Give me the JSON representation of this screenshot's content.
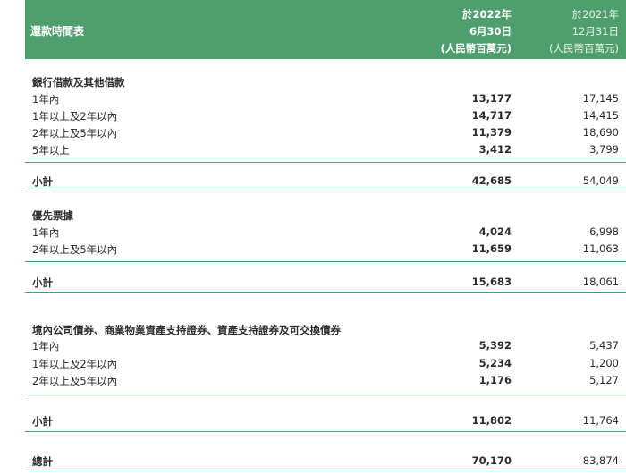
{
  "header": {
    "title": "還款時間表",
    "col1": [
      "於2022年",
      "6月30日",
      "(人民幣百萬元)"
    ],
    "col2": [
      "於2021年",
      "12月31日",
      "(人民幣百萬元)"
    ]
  },
  "sections": [
    {
      "heading": "銀行借款及其他借款",
      "rows": [
        {
          "label": "1年內",
          "v2022": "13,177",
          "v2021": "17,145"
        },
        {
          "label": "1年以上及2年以內",
          "v2022": "14,717",
          "v2021": "14,415"
        },
        {
          "label": "2年以上及5年以內",
          "v2022": "11,379",
          "v2021": "18,690"
        },
        {
          "label": "5年以上",
          "v2022": "3,412",
          "v2021": "3,799"
        }
      ],
      "subtotal": {
        "label": "小計",
        "v2022": "42,685",
        "v2021": "54,049"
      }
    },
    {
      "heading": "優先票據",
      "rows": [
        {
          "label": "1年內",
          "v2022": "4,024",
          "v2021": "6,998"
        },
        {
          "label": "2年以上及5年以內",
          "v2022": "11,659",
          "v2021": "11,063"
        }
      ],
      "subtotal": {
        "label": "小計",
        "v2022": "15,683",
        "v2021": "18,061"
      }
    },
    {
      "heading": "境內公司債券、商業物業資產支持證券、資產支持證券及可交換債券",
      "rows": [
        {
          "label": "1年內",
          "v2022": "5,392",
          "v2021": "5,437"
        },
        {
          "label": "1年以上及2年以內",
          "v2022": "5,234",
          "v2021": "1,200"
        },
        {
          "label": "2年以上及5年以內",
          "v2022": "1,176",
          "v2021": "5,127"
        }
      ],
      "subtotal": {
        "label": "小計",
        "v2022": "11,802",
        "v2021": "11,764"
      }
    }
  ],
  "grand_total": {
    "label": "總計",
    "v2022": "70,170",
    "v2021": "83,874"
  },
  "colors": {
    "accent": "#4f9f6e"
  }
}
